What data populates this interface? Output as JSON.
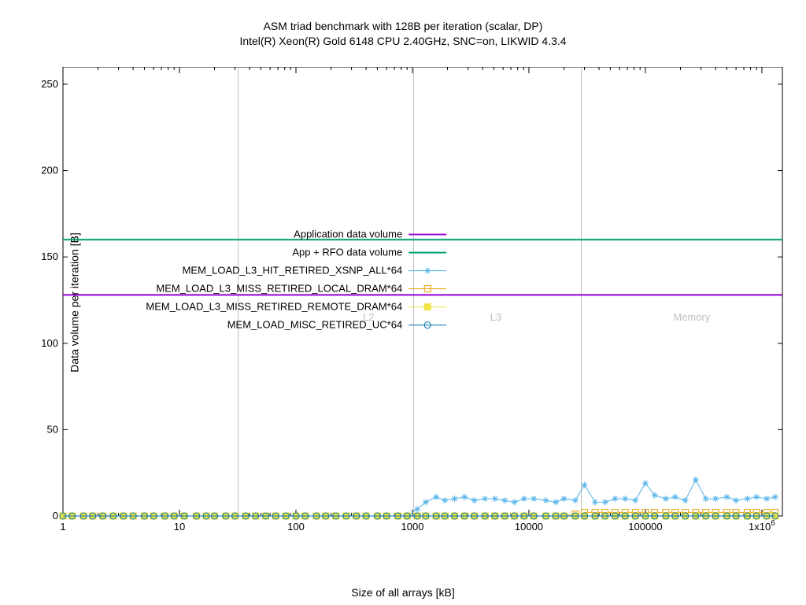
{
  "chart_data": {
    "type": "line",
    "title": "ASM triad benchmark with 128B per iteration (scalar, DP)",
    "subtitle": "Intel(R) Xeon(R) Gold 6148 CPU 2.40GHz, SNC=on, LIKWID 4.3.4",
    "xlabel": "Size of all arrays [kB]",
    "ylabel": "Data volume per iteration [B]",
    "xscale": "log",
    "xlim": [
      1,
      1500000
    ],
    "ylim": [
      0,
      260
    ],
    "x": [
      1,
      1.2,
      1.5,
      1.8,
      2.2,
      2.7,
      3.3,
      4,
      5,
      6,
      7.5,
      9,
      11,
      14,
      17,
      20,
      25,
      30,
      37,
      45,
      55,
      67,
      82,
      100,
      120,
      150,
      180,
      220,
      270,
      330,
      400,
      500,
      600,
      750,
      900,
      1100,
      1300,
      1600,
      1900,
      2300,
      2800,
      3400,
      4200,
      5100,
      6200,
      7500,
      9100,
      11000,
      14000,
      17000,
      20000,
      25000,
      30000,
      37000,
      45000,
      55000,
      67000,
      82000,
      100000,
      120000,
      150000,
      180000,
      220000,
      270000,
      330000,
      400000,
      500000,
      600000,
      750000,
      900000,
      1100000,
      1300000
    ],
    "xticks": [
      1,
      10,
      100,
      1000,
      10000,
      100000,
      1000000
    ],
    "xticklabels": [
      "1",
      "10",
      "100",
      "1000",
      "10000",
      "100000",
      "1x10^6"
    ],
    "yticks": [
      0,
      50,
      100,
      150,
      200,
      250
    ],
    "series": [
      {
        "name": "Application data volume",
        "type": "hline",
        "value": 128,
        "color": "#9400d3",
        "width": 2
      },
      {
        "name": "App + RFO data volume",
        "type": "hline",
        "value": 160,
        "color": "#009e73",
        "width": 2
      },
      {
        "name": "MEM_LOAD_L3_HIT_RETIRED_XSNP_ALL*64",
        "type": "line",
        "marker": "asterisk",
        "color": "#56b4e9",
        "values": [
          0,
          0,
          0,
          0,
          0,
          0,
          0,
          0,
          0,
          0,
          0,
          0,
          0,
          0,
          0,
          0,
          0,
          0,
          0,
          0,
          0,
          0,
          0,
          0,
          0,
          0,
          0,
          0,
          0,
          0,
          0,
          0,
          0,
          0,
          0,
          4,
          8,
          11,
          9,
          10,
          11,
          9,
          10,
          10,
          9,
          8,
          10,
          10,
          9,
          8,
          10,
          9,
          18,
          8,
          8,
          10,
          10,
          9,
          19,
          12,
          10,
          11,
          9,
          21,
          10,
          10,
          11,
          9,
          10,
          11,
          10,
          11
        ]
      },
      {
        "name": "MEM_LOAD_L3_MISS_RETIRED_LOCAL_DRAM*64",
        "type": "line",
        "marker": "open-square",
        "color": "#e69f00",
        "values": [
          0,
          0,
          0,
          0,
          0,
          0,
          0,
          0,
          0,
          0,
          0,
          0,
          0,
          0,
          0,
          0,
          0,
          0,
          0,
          0,
          0,
          0,
          0,
          0,
          0,
          0,
          0,
          0,
          0,
          0,
          0,
          0,
          0,
          0,
          0,
          0,
          0,
          0,
          0,
          0,
          0,
          0,
          0,
          0,
          0,
          0,
          0,
          0,
          0,
          0,
          0,
          1,
          2,
          2,
          2,
          2,
          2,
          2,
          2,
          2,
          2,
          2,
          2,
          2,
          2,
          2,
          2,
          2,
          2,
          2,
          2,
          2
        ]
      },
      {
        "name": "MEM_LOAD_L3_MISS_RETIRED_REMOTE_DRAM*64",
        "type": "line",
        "marker": "square",
        "color": "#f0e442",
        "values": [
          0,
          0,
          0,
          0,
          0,
          0,
          0,
          0,
          0,
          0,
          0,
          0,
          0,
          0,
          0,
          0,
          0,
          0,
          0,
          0,
          0,
          0,
          0,
          0,
          0,
          0,
          0,
          0,
          0,
          0,
          0,
          0,
          0,
          0,
          0,
          0,
          0,
          0,
          0,
          0,
          0,
          0,
          0,
          0,
          0,
          0,
          0,
          0,
          0,
          0,
          0,
          0,
          0,
          0,
          0,
          0,
          0,
          0,
          0,
          0,
          0,
          0,
          0,
          0,
          0,
          0,
          0,
          0,
          0,
          0,
          0,
          0
        ]
      },
      {
        "name": "MEM_LOAD_MISC_RETIRED_UC*64",
        "type": "line",
        "marker": "open-circle",
        "color": "#0072b2",
        "values": [
          0,
          0,
          0,
          0,
          0,
          0,
          0,
          0,
          0,
          0,
          0,
          0,
          0,
          0,
          0,
          0,
          0,
          0,
          0,
          0,
          0,
          0,
          0,
          0,
          0,
          0,
          0,
          0,
          0,
          0,
          0,
          0,
          0,
          0,
          0,
          0,
          0,
          0,
          0,
          0,
          0,
          0,
          0,
          0,
          0,
          0,
          0,
          0,
          0,
          0,
          0,
          0,
          0,
          0,
          0,
          0,
          0,
          0,
          0,
          0,
          0,
          0,
          0,
          0,
          0,
          0,
          0,
          0,
          0,
          0,
          0,
          0
        ]
      }
    ],
    "region_dividers": [
      {
        "x": 32,
        "label": ""
      },
      {
        "x": 1024,
        "label": ""
      },
      {
        "x": 28160,
        "label": ""
      }
    ],
    "region_labels": [
      {
        "text": "L2",
        "x_center": 420
      },
      {
        "text": "L3",
        "x_center": 5200
      },
      {
        "text": "Memory",
        "x_center": 250000
      }
    ]
  },
  "legend_title": "",
  "legend_entries": [
    "Application data volume",
    "App + RFO data volume",
    "MEM_LOAD_L3_HIT_RETIRED_XSNP_ALL*64",
    "MEM_LOAD_L3_MISS_RETIRED_LOCAL_DRAM*64",
    "MEM_LOAD_L3_MISS_RETIRED_REMOTE_DRAM*64",
    "MEM_LOAD_MISC_RETIRED_UC*64"
  ]
}
